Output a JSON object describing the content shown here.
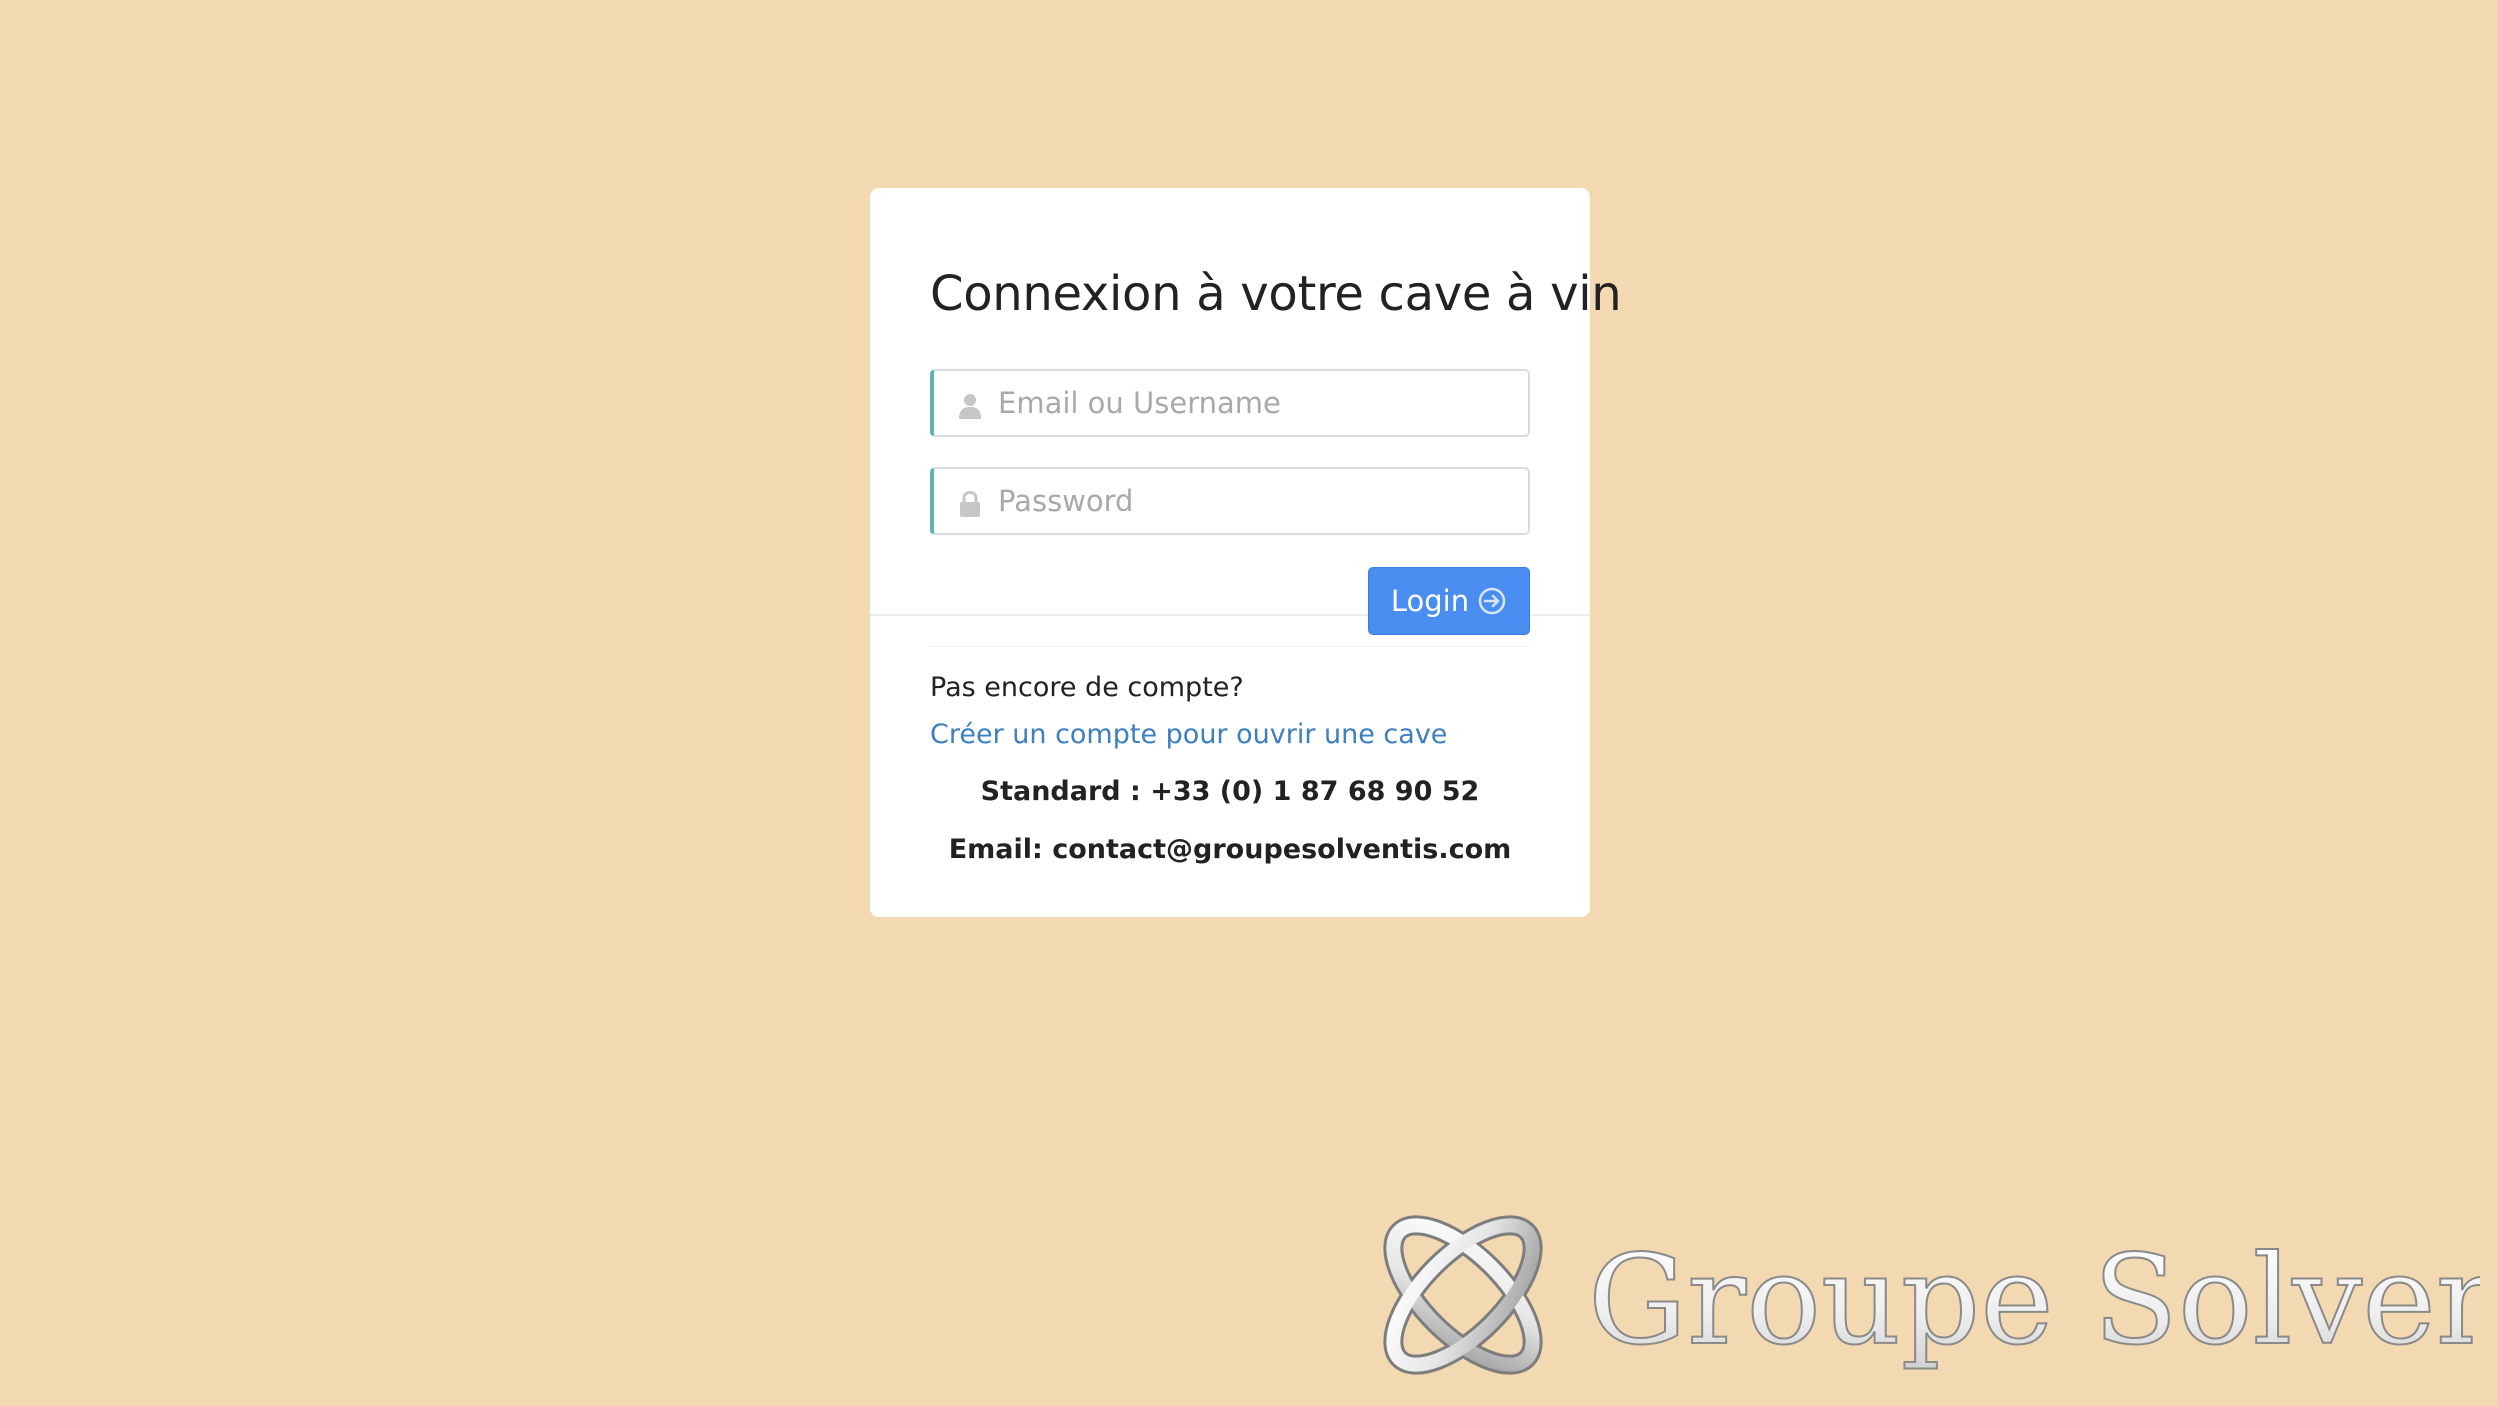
{
  "page": {
    "background_color": "#f2d9b1"
  },
  "login": {
    "title": "Connexion à votre cave à vin",
    "email_placeholder": "Email ou Username",
    "password_placeholder": "Password",
    "login_button_label": "Login",
    "accent_color": "#4a8df0",
    "field_accent_color": "#5cb3b6"
  },
  "signup": {
    "prompt": "Pas encore de compte?",
    "link_label": "Créer un compte pour ouvrir une cave",
    "link_color": "#3d7fbf"
  },
  "contact": {
    "phone_line": "Standard : +33 (0) 1 87 68 90 52",
    "email_line": "Email: contact@groupesolventis.com"
  },
  "brand": {
    "name": "Groupe Solventis",
    "logo_icon": "interlocking-rings-logo"
  },
  "icons": {
    "email_field": "user-icon",
    "password_field": "lock-icon",
    "login_button": "arrow-circle-right-icon"
  }
}
